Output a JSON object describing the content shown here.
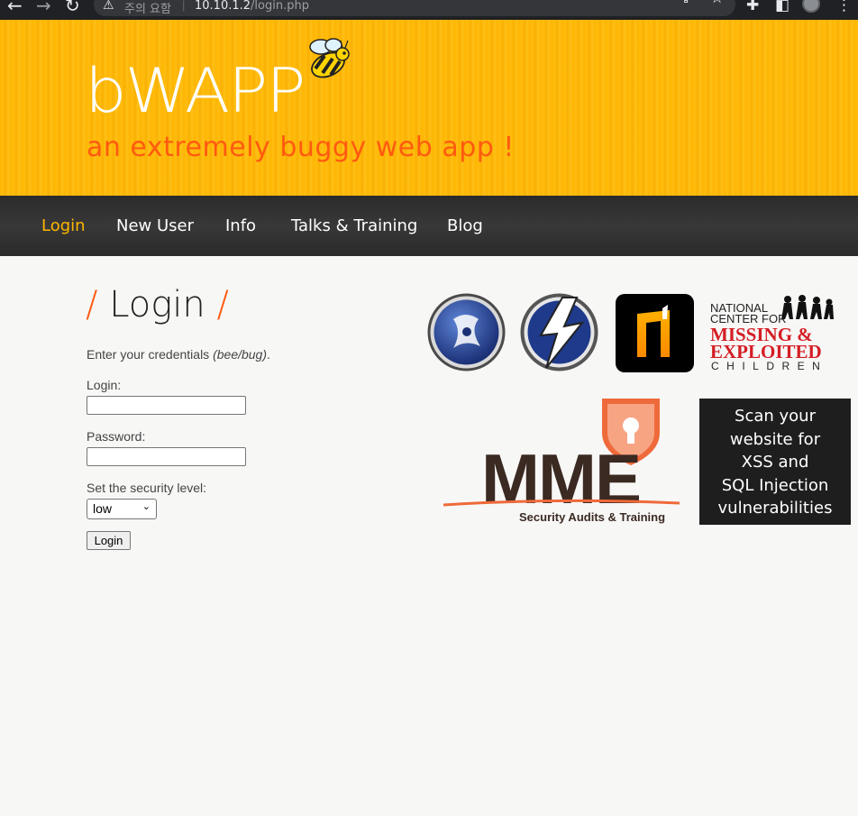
{
  "browser": {
    "warning": "주의 요함",
    "url_host": "10.10.1.2",
    "url_path": "/login.php"
  },
  "header": {
    "logo": "bWAPP",
    "tagline": "an extremely buggy web app !"
  },
  "menu": {
    "items": [
      "Login",
      "New User",
      "Info",
      "Talks & Training",
      "Blog"
    ]
  },
  "main": {
    "title": "Login",
    "title_slash": "/",
    "intro_text": "Enter your credentials ",
    "intro_hint": "(bee/bug)",
    "intro_end": ".",
    "login_label": "Login:",
    "login_value": "",
    "password_label": "Password:",
    "password_value": "",
    "security_label": "Set the security level:",
    "security_value": "low",
    "submit_label": "Login"
  },
  "sponsors": {
    "ncmec_line1": "NATIONAL",
    "ncmec_line2": "CENTER FOR",
    "ncmec_line3": "MISSING &",
    "ncmec_line4": "EXPLOITED",
    "ncmec_line5": "CHILDREN",
    "mme_name": "MME",
    "mme_tagline": "Security Audits & Training",
    "scan_lines": [
      "Scan your",
      "website for",
      "XSS and",
      "SQL Injection",
      "vulnerabilities"
    ]
  },
  "colors": {
    "brand_orange": "#ff5a10",
    "header_yellow": "#ffb600",
    "menu_active": "#ffb600"
  }
}
